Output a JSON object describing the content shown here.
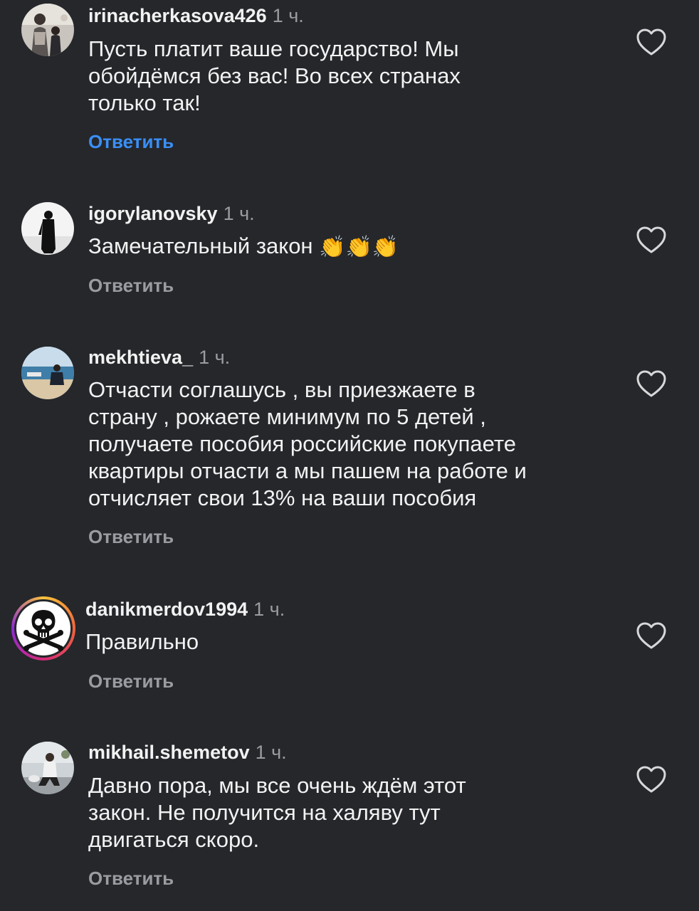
{
  "comments": [
    {
      "username": "irinacherkasova426",
      "time": "1 ч.",
      "text_lines": [
        "Пусть платит ваше государство! Мы",
        "обойдёмся без вас! Во всех странах",
        "только так!"
      ],
      "reply_label": "Ответить",
      "reply_active": true,
      "liked": false
    },
    {
      "username": "igorylanovsky",
      "time": "1 ч.",
      "text_lines": [
        "Замечательный закон"
      ],
      "emoji": "👏👏👏",
      "reply_label": "Ответить",
      "reply_active": false,
      "liked": false
    },
    {
      "username": "mekhtieva_",
      "time": "1 ч.",
      "text_lines": [
        "Отчасти соглашусь , вы приезжаете в",
        "страну , рожаете минимум по 5 детей ,",
        "получаете пособия российские покупаете",
        "квартиры отчасти а мы пашем на работе и",
        "отчисляет свои 13% на ваши пособия"
      ],
      "reply_label": "Ответить",
      "reply_active": false,
      "liked": false
    },
    {
      "username": "danikmerdov1994",
      "time": "1 ч.",
      "text_lines": [
        "Правильно"
      ],
      "reply_label": "Ответить",
      "reply_active": false,
      "liked": false
    },
    {
      "username": "mikhail.shemetov",
      "time": "1 ч.",
      "text_lines": [
        "Давно пора, мы все очень ждём этот",
        "закон. Не получится на халяву тут",
        "двигаться скоро."
      ],
      "reply_label": "Ответить",
      "reply_active": false,
      "liked": false
    }
  ],
  "colors": {
    "background": "#25272b",
    "text": "#f2f2f2",
    "muted": "#9a9ca1",
    "reply_active": "#3a8ff5"
  }
}
